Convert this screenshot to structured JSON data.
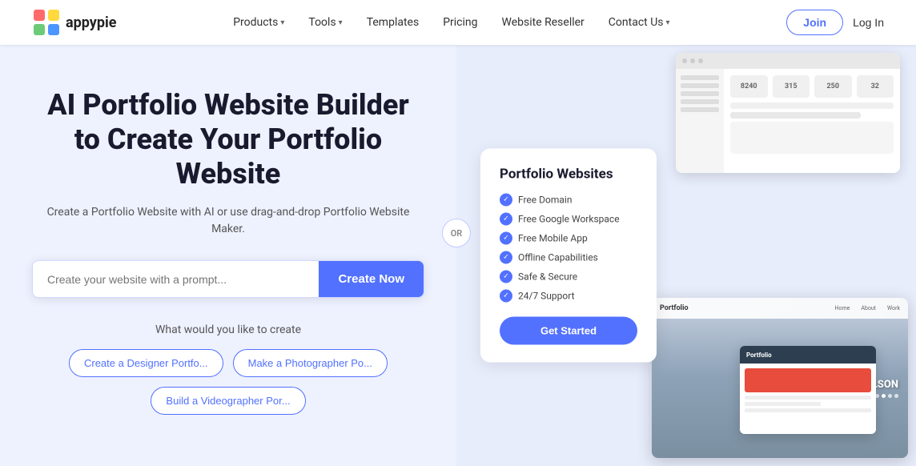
{
  "navbar": {
    "logo_text": "appypie",
    "links": [
      {
        "label": "Products",
        "has_dropdown": true
      },
      {
        "label": "Tools",
        "has_dropdown": true
      },
      {
        "label": "Templates",
        "has_dropdown": false
      },
      {
        "label": "Pricing",
        "has_dropdown": false
      },
      {
        "label": "Website Reseller",
        "has_dropdown": false
      },
      {
        "label": "Contact Us",
        "has_dropdown": true
      }
    ],
    "join_label": "Join",
    "login_label": "Log In"
  },
  "hero": {
    "title": "AI Portfolio Website Builder to Create Your Portfolio Website",
    "subtitle": "Create a Portfolio Website with AI or use drag-and-drop Portfolio Website Maker.",
    "search_placeholder": "Create your website with a prompt...",
    "create_now_label": "Create Now",
    "what_create_label": "What would you like to create",
    "or_divider": "OR"
  },
  "suggestions": [
    {
      "label": "Create a Designer Portfo..."
    },
    {
      "label": "Make a Photographer Po..."
    },
    {
      "label": "Build a Videographer Por..."
    }
  ],
  "portfolio_card": {
    "title": "Portfolio Websites",
    "features": [
      "Free Domain",
      "Free Google Workspace",
      "Free Mobile App",
      "Offline Capabilities",
      "Safe & Secure",
      "24/7 Support"
    ],
    "cta_label": "Get Started"
  },
  "mockup": {
    "stats": [
      "8240",
      "315",
      "250",
      "32"
    ],
    "person_name": "DAVID WILSON",
    "portfolio_label": "Portfolio"
  }
}
